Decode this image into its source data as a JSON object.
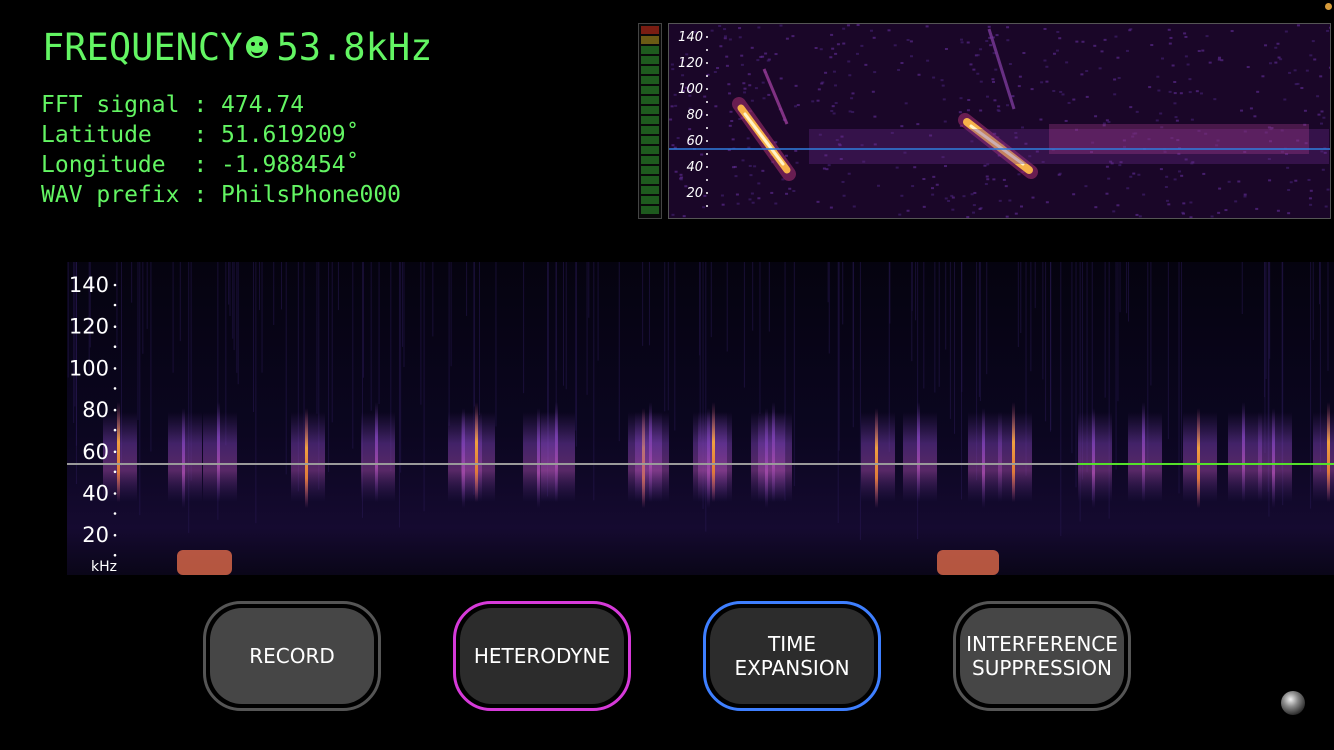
{
  "readout": {
    "frequency_label": "FREQUENCY",
    "frequency_value": "53.8kHz",
    "fft_line": "FFT signal : 474.74",
    "latitude_line": "Latitude   : 51.619209˚",
    "longitude_line": "Longitude  : -1.988454˚",
    "wav_line": "WAV prefix : PhilsPhone000"
  },
  "small_spectrogram": {
    "ticks": [
      "140",
      "120",
      "100",
      "80",
      "60",
      "40",
      "20"
    ],
    "marker_line_color": "#2f7fe0"
  },
  "main_spectrogram": {
    "ticks": [
      "140",
      "120",
      "100",
      "80",
      "60",
      "40",
      "20"
    ],
    "unit": "kHz",
    "marker_line_color": "#9a9a9a",
    "marker_line_active_color": "#55e02a"
  },
  "buttons": {
    "record": "RECORD",
    "heterodyne": "HETERODYNE",
    "time_expansion": "TIME\nEXPANSION",
    "interference": "INTERFERENCE\nSUPPRESSION"
  },
  "colors": {
    "text_green": "#63f563",
    "heterodyne_border": "#d63ad9",
    "time_expansion_border": "#3e7fff"
  },
  "icons": [
    "smiley-face-icon",
    "status-orb-icon"
  ]
}
